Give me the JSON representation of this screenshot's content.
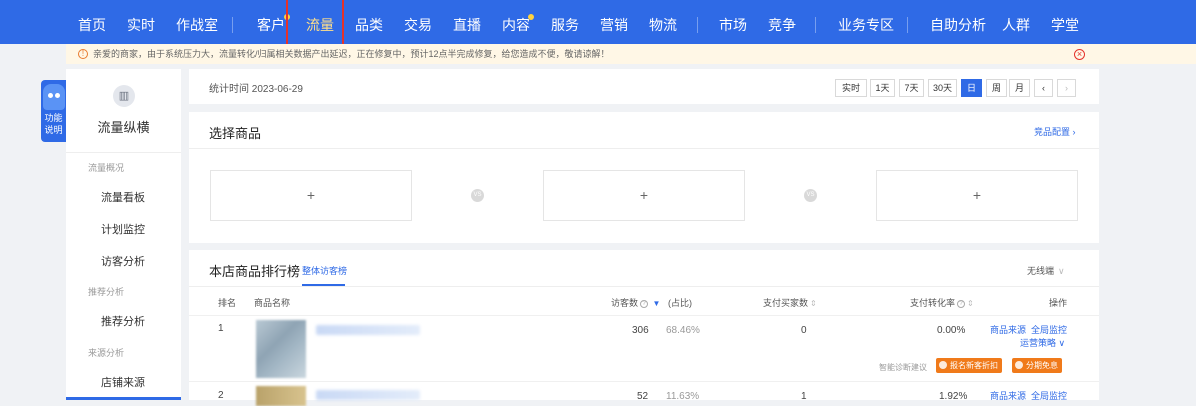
{
  "topnav": {
    "items": [
      {
        "label": "首页"
      },
      {
        "label": "实时"
      },
      {
        "label": "作战室"
      },
      {
        "label": "客户"
      },
      {
        "label": "流量"
      },
      {
        "label": "品类"
      },
      {
        "label": "交易"
      },
      {
        "label": "直播"
      },
      {
        "label": "内容"
      },
      {
        "label": "服务"
      },
      {
        "label": "营销"
      },
      {
        "label": "物流"
      },
      {
        "label": "市场"
      },
      {
        "label": "竞争"
      },
      {
        "label": "业务专区"
      },
      {
        "label": "自助分析"
      },
      {
        "label": "人群"
      },
      {
        "label": "学堂"
      }
    ],
    "active": "流量",
    "colors": {
      "background": "#2f6ae6",
      "dot": "#ffd23f",
      "highlight": "#e5322b"
    }
  },
  "notice": {
    "text": "亲爱的商家，由于系统压力大，流量转化/归属相关数据产出延迟，正在修复中，预计12点半完成修复，给您造成不便，敬请谅解！"
  },
  "helper": {
    "label_line1": "功能",
    "label_line2": "说明"
  },
  "sidebar": {
    "title": "流量纵横",
    "groups": [
      {
        "label": "流量概况",
        "items": [
          "流量看板",
          "计划监控",
          "访客分析"
        ]
      },
      {
        "label": "推荐分析",
        "items": [
          "推荐分析"
        ]
      },
      {
        "label": "来源分析",
        "items": [
          "店铺来源"
        ]
      }
    ]
  },
  "datebar": {
    "label": "统计时间 2023-06-29",
    "buttons": [
      "实时",
      "1天",
      "7天",
      "30天",
      "日",
      "周",
      "月"
    ],
    "active": "日",
    "prev": "‹",
    "next": "›"
  },
  "select": {
    "title": "选择商品",
    "config": "竞品配置 ›",
    "slot_symbol": "+",
    "vs_label": "VS"
  },
  "rank": {
    "title": "本店商品排行榜",
    "tab": "整体访客榜",
    "filter": "无线端",
    "headers": {
      "rank": "排名",
      "name": "商品名称",
      "visitors": "访客数",
      "share": "(占比)",
      "buyers": "支付买家数",
      "conversion": "支付转化率",
      "action": "操作"
    },
    "rows": [
      {
        "rank": "1",
        "visitors": "306",
        "share": "68.46%",
        "buyers": "0",
        "conversion": "0.00%",
        "actions": [
          "商品来源",
          "全局监控",
          "运营策略 ∨"
        ]
      },
      {
        "rank": "2",
        "visitors": "52",
        "share": "11.63%",
        "buyers": "1",
        "conversion": "1.92%",
        "actions": [
          "商品来源",
          "全局监控"
        ]
      }
    ],
    "diag_label": "智能诊断建议",
    "tags": [
      "报名新客折扣",
      "分期免息"
    ],
    "colors": {
      "link": "#2f6ae6",
      "tag": "#f07a1a"
    }
  }
}
